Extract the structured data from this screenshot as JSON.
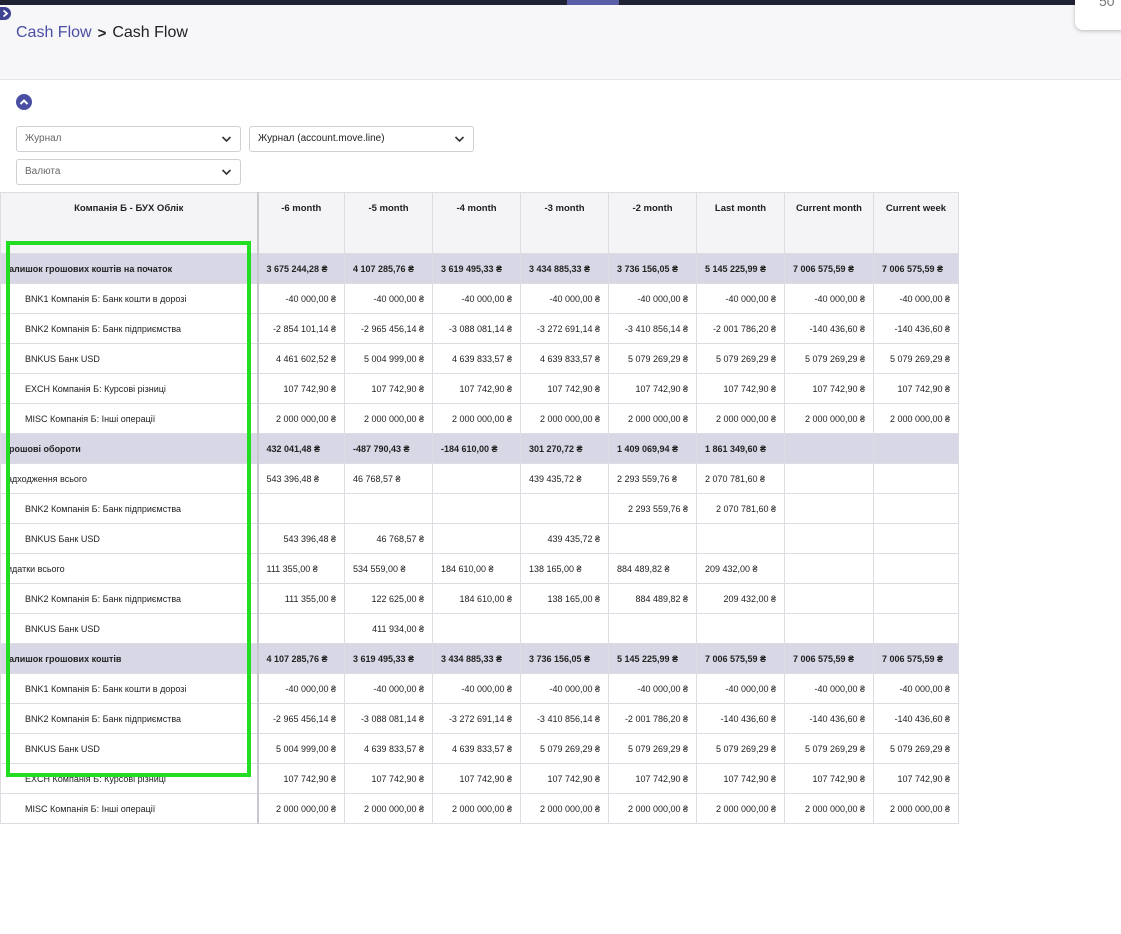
{
  "header": {
    "breadcrumb": [
      "Cash Flow",
      "Cash Flow"
    ],
    "corner_card_text": "50"
  },
  "filters": {
    "journal": {
      "placeholder": "Журнал"
    },
    "journal_model": {
      "value": "Журнал (account.move.line)"
    },
    "currency": {
      "placeholder": "Валюта"
    }
  },
  "icons": [
    "chevron-right-icon",
    "chevron-up-icon",
    "chevron-down-icon"
  ],
  "colors": {
    "accent": "#4a4fa3",
    "total_row": "#d7d7e6",
    "highlight": "#22dd22"
  },
  "table": {
    "company_header": "Компанія Б - БУХ Облік",
    "columns": [
      "-6 month",
      "-5 month",
      "-4 month",
      "-3 month",
      "-2 month",
      "Last month",
      "Current month",
      "Current week"
    ],
    "rows": [
      {
        "type": "total",
        "label": "алишок грошових коштів на початок",
        "values": [
          "3 675 244,28 ₴",
          "4 107 285,76 ₴",
          "3 619 495,33 ₴",
          "3 434 885,33 ₴",
          "3 736 156,05 ₴",
          "5 145 225,99 ₴",
          "7 006 575,59 ₴",
          "7 006 575,59 ₴"
        ]
      },
      {
        "type": "acct",
        "label": "BNK1 Компанія Б: Банк кошти в дорозі",
        "values": [
          "-40 000,00 ₴",
          "-40 000,00 ₴",
          "-40 000,00 ₴",
          "-40 000,00 ₴",
          "-40 000,00 ₴",
          "-40 000,00 ₴",
          "-40 000,00 ₴",
          "-40 000,00 ₴"
        ]
      },
      {
        "type": "acct",
        "label": "BNK2 Компанія Б: Банк підприємства",
        "values": [
          "-2 854 101,14 ₴",
          "-2 965 456,14 ₴",
          "-3 088 081,14 ₴",
          "-3 272 691,14 ₴",
          "-3 410 856,14 ₴",
          "-2 001 786,20 ₴",
          "-140 436,60 ₴",
          "-140 436,60 ₴"
        ]
      },
      {
        "type": "acct",
        "label": "BNKUS Банк USD",
        "values": [
          "4 461 602,52 ₴",
          "5 004 999,00 ₴",
          "4 639 833,57 ₴",
          "4 639 833,57 ₴",
          "5 079 269,29 ₴",
          "5 079 269,29 ₴",
          "5 079 269,29 ₴",
          "5 079 269,29 ₴"
        ]
      },
      {
        "type": "acct",
        "label": "EXCH Компанія Б: Курсові різниці",
        "values": [
          "107 742,90 ₴",
          "107 742,90 ₴",
          "107 742,90 ₴",
          "107 742,90 ₴",
          "107 742,90 ₴",
          "107 742,90 ₴",
          "107 742,90 ₴",
          "107 742,90 ₴"
        ]
      },
      {
        "type": "acct",
        "label": "MISC Компанія Б: Інші операції",
        "values": [
          "2 000 000,00 ₴",
          "2 000 000,00 ₴",
          "2 000 000,00 ₴",
          "2 000 000,00 ₴",
          "2 000 000,00 ₴",
          "2 000 000,00 ₴",
          "2 000 000,00 ₴",
          "2 000 000,00 ₴"
        ]
      },
      {
        "type": "total",
        "label": "рошові обороти",
        "values": [
          "432 041,48 ₴",
          "-487 790,43 ₴",
          "-184 610,00 ₴",
          "301 270,72 ₴",
          "1 409 069,94 ₴",
          "1 861 349,60 ₴",
          "",
          ""
        ]
      },
      {
        "type": "sub",
        "label": "адходження всього",
        "values": [
          "543 396,48 ₴",
          "46 768,57 ₴",
          "",
          "439 435,72 ₴",
          "2 293 559,76 ₴",
          "2 070 781,60 ₴",
          "",
          ""
        ]
      },
      {
        "type": "acct",
        "label": "BNK2 Компанія Б: Банк підприємства",
        "values": [
          "",
          "",
          "",
          "",
          "2 293 559,76 ₴",
          "2 070 781,60 ₴",
          "",
          ""
        ]
      },
      {
        "type": "acct",
        "label": "BNKUS Банк USD",
        "values": [
          "543 396,48 ₴",
          "46 768,57 ₴",
          "",
          "439 435,72 ₴",
          "",
          "",
          "",
          ""
        ]
      },
      {
        "type": "sub",
        "label": "идатки всього",
        "values": [
          "111 355,00 ₴",
          "534 559,00 ₴",
          "184 610,00 ₴",
          "138 165,00 ₴",
          "884 489,82 ₴",
          "209 432,00 ₴",
          "",
          ""
        ]
      },
      {
        "type": "acct",
        "label": "BNK2 Компанія Б: Банк підприємства",
        "values": [
          "111 355,00 ₴",
          "122 625,00 ₴",
          "184 610,00 ₴",
          "138 165,00 ₴",
          "884 489,82 ₴",
          "209 432,00 ₴",
          "",
          ""
        ]
      },
      {
        "type": "acct",
        "label": "BNKUS Банк USD",
        "values": [
          "",
          "411 934,00 ₴",
          "",
          "",
          "",
          "",
          "",
          ""
        ]
      },
      {
        "type": "total",
        "label": "алишок грошових коштів",
        "values": [
          "4 107 285,76 ₴",
          "3 619 495,33 ₴",
          "3 434 885,33 ₴",
          "3 736 156,05 ₴",
          "5 145 225,99 ₴",
          "7 006 575,59 ₴",
          "7 006 575,59 ₴",
          "7 006 575,59 ₴"
        ]
      },
      {
        "type": "acct",
        "label": "BNK1 Компанія Б: Банк кошти в дорозі",
        "values": [
          "-40 000,00 ₴",
          "-40 000,00 ₴",
          "-40 000,00 ₴",
          "-40 000,00 ₴",
          "-40 000,00 ₴",
          "-40 000,00 ₴",
          "-40 000,00 ₴",
          "-40 000,00 ₴"
        ]
      },
      {
        "type": "acct",
        "label": "BNK2 Компанія Б: Банк підприємства",
        "values": [
          "-2 965 456,14 ₴",
          "-3 088 081,14 ₴",
          "-3 272 691,14 ₴",
          "-3 410 856,14 ₴",
          "-2 001 786,20 ₴",
          "-140 436,60 ₴",
          "-140 436,60 ₴",
          "-140 436,60 ₴"
        ]
      },
      {
        "type": "acct",
        "label": "BNKUS Банк USD",
        "values": [
          "5 004 999,00 ₴",
          "4 639 833,57 ₴",
          "4 639 833,57 ₴",
          "5 079 269,29 ₴",
          "5 079 269,29 ₴",
          "5 079 269,29 ₴",
          "5 079 269,29 ₴",
          "5 079 269,29 ₴"
        ]
      },
      {
        "type": "acct",
        "label": "EXCH Компанія Б: Курсові різниці",
        "values": [
          "107 742,90 ₴",
          "107 742,90 ₴",
          "107 742,90 ₴",
          "107 742,90 ₴",
          "107 742,90 ₴",
          "107 742,90 ₴",
          "107 742,90 ₴",
          "107 742,90 ₴"
        ]
      },
      {
        "type": "acct",
        "label": "MISC Компанія Б: Інші операції",
        "values": [
          "2 000 000,00 ₴",
          "2 000 000,00 ₴",
          "2 000 000,00 ₴",
          "2 000 000,00 ₴",
          "2 000 000,00 ₴",
          "2 000 000,00 ₴",
          "2 000 000,00 ₴",
          "2 000 000,00 ₴"
        ]
      }
    ]
  }
}
